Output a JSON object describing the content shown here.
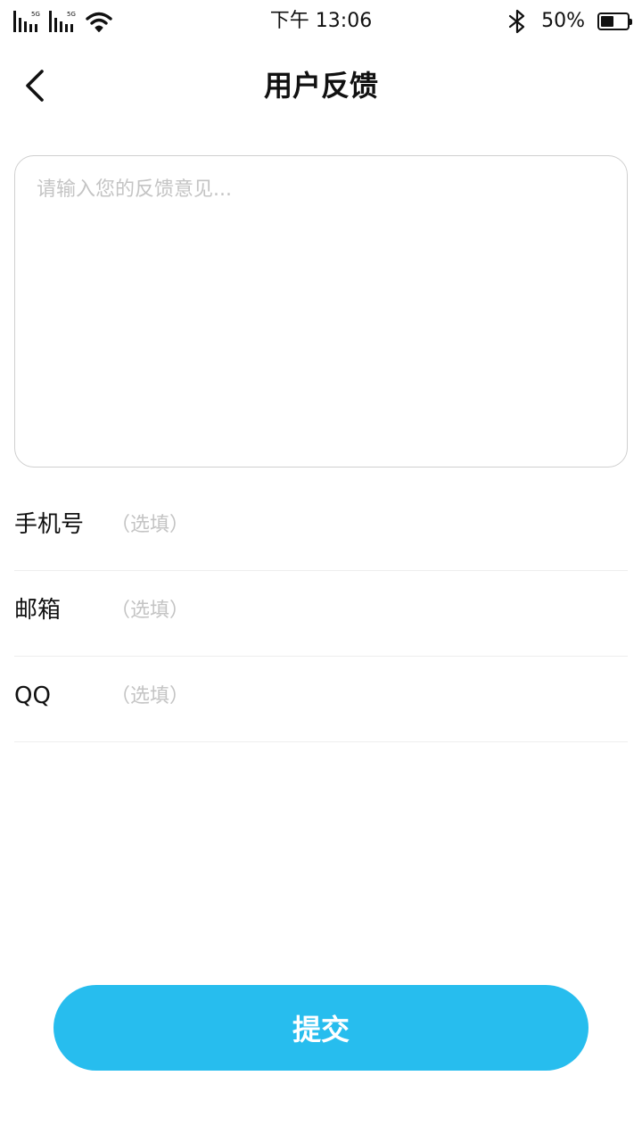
{
  "status_bar": {
    "signal_1_label": "5G",
    "signal_2_label": "5G",
    "time": "下午 13:06",
    "battery_percent_text": "50%",
    "battery_level": 0.5,
    "icons": [
      "signal-icon",
      "wifi-icon",
      "bluetooth-icon",
      "battery-icon"
    ]
  },
  "header": {
    "title": "用户反馈",
    "back_icon": "chevron-left-icon"
  },
  "feedback": {
    "placeholder": "请输入您的反馈意见...",
    "value": ""
  },
  "form": {
    "rows": [
      {
        "label": "手机号",
        "placeholder": "（选填）",
        "value": ""
      },
      {
        "label": "邮箱",
        "placeholder": "（选填）",
        "value": ""
      },
      {
        "label": "QQ",
        "placeholder": "（选填）",
        "value": ""
      }
    ]
  },
  "submit": {
    "label": "提交"
  },
  "colors": {
    "accent": "#27bdee",
    "placeholder": "#c4c4c4",
    "border": "#cfcfcf",
    "divider": "#eeeeee"
  }
}
